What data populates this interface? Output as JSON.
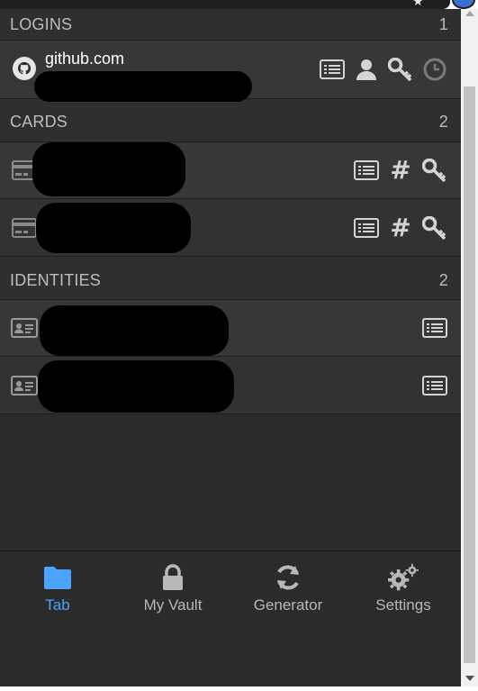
{
  "sections": {
    "logins": {
      "title": "LOGINS",
      "count": "1"
    },
    "cards": {
      "title": "CARDS",
      "count": "2"
    },
    "identities": {
      "title": "IDENTITIES",
      "count": "2"
    }
  },
  "logins": [
    {
      "name": "github.com",
      "icon": "github-icon"
    }
  ],
  "tabs": [
    {
      "label": "Tab",
      "icon": "folder-icon"
    },
    {
      "label": "My Vault",
      "icon": "lock-icon"
    },
    {
      "label": "Generator",
      "icon": "refresh-icon"
    },
    {
      "label": "Settings",
      "icon": "gears-icon"
    }
  ],
  "colors": {
    "background": "#2b2b2b",
    "row": "#373737",
    "header_text": "#bdbdbd",
    "accent": "#4aa3ff",
    "icon": "#d4d4d4"
  }
}
